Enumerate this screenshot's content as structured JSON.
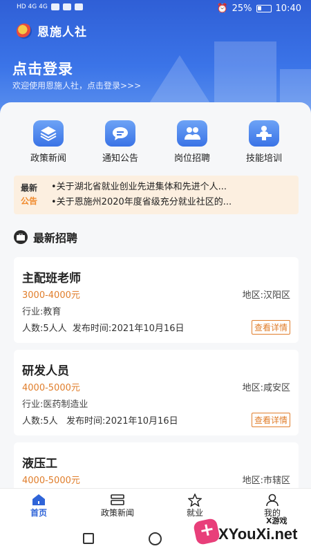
{
  "status_bar": {
    "left_signal": "HD 4G 4G",
    "battery": "25%",
    "time": "10:40"
  },
  "header": {
    "app_name": "恩施人社",
    "login_title": "点击登录",
    "login_subtitle": "欢迎使用恩施人社，点击登录>>>"
  },
  "nav": [
    {
      "label": "政策新闻",
      "icon": "layers-icon"
    },
    {
      "label": "通知公告",
      "icon": "chat-bubble-icon"
    },
    {
      "label": "岗位招聘",
      "icon": "people-icon"
    },
    {
      "label": "技能培训",
      "icon": "lectern-icon"
    }
  ],
  "notice": {
    "tag_line1": "最新",
    "tag_line2": "公告",
    "items": [
      "•关于湖北省就业创业先进集体和先进个人...",
      "•关于恩施州2020年度省级充分就业社区的..."
    ]
  },
  "section": {
    "title": "最新招聘"
  },
  "jobs": [
    {
      "title": "主配班老师",
      "salary": "3000-4000元",
      "region": "地区:汉阳区",
      "industry": "行业:教育",
      "meta": "人数:5人人  发布时间:2021年10月16日",
      "detail_label": "查看详情"
    },
    {
      "title": "研发人员",
      "salary": "4000-5000元",
      "region": "地区:咸安区",
      "industry": "行业:医药制造业",
      "meta": "人数:5人   发布时间:2021年10月16日",
      "detail_label": "查看详情"
    },
    {
      "title": "液压工",
      "salary": "4000-5000元",
      "region": "地区:市辖区",
      "industry": "",
      "meta": "",
      "detail_label": ""
    }
  ],
  "tabbar": [
    {
      "label": "首页",
      "icon": "home-icon",
      "active": true
    },
    {
      "label": "政策新闻",
      "icon": "news-icon",
      "active": false
    },
    {
      "label": "就业",
      "icon": "star-icon",
      "active": false
    },
    {
      "label": "我的",
      "icon": "user-icon",
      "active": false
    }
  ],
  "watermark": {
    "top_text": "X游戏",
    "main_text": "XYouXi.net"
  },
  "colors": {
    "header_blue": "#3b74e8",
    "accent_orange": "#e07d2a",
    "active_tab": "#2f64d8"
  }
}
